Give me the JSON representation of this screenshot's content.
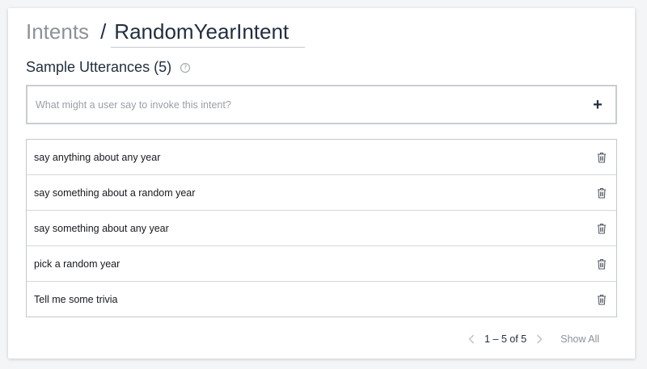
{
  "header": {
    "breadcrumb_root": "Intents",
    "separator": "/",
    "intent_name": "RandomYearIntent"
  },
  "section": {
    "title": "Sample Utterances (5)",
    "help_icon": "?"
  },
  "add_utterance": {
    "placeholder": "What might a user say to invoke this intent?",
    "value": "",
    "add_label": "+"
  },
  "utterances": [
    {
      "text": "say anything about any year"
    },
    {
      "text": "say something about a random year"
    },
    {
      "text": "say something about any year"
    },
    {
      "text": "pick a random year"
    },
    {
      "text": "Tell me some trivia"
    }
  ],
  "pagination": {
    "range": "1 – 5 of 5",
    "show_all": "Show All"
  },
  "icons": {
    "row_action": "trash-icon",
    "prev": "chevron-left-icon",
    "next": "chevron-right-icon"
  },
  "colors": {
    "text": "#232f3e",
    "muted": "#8d9297",
    "border": "#c4c8cc",
    "disabled": "#c4c8cc"
  }
}
